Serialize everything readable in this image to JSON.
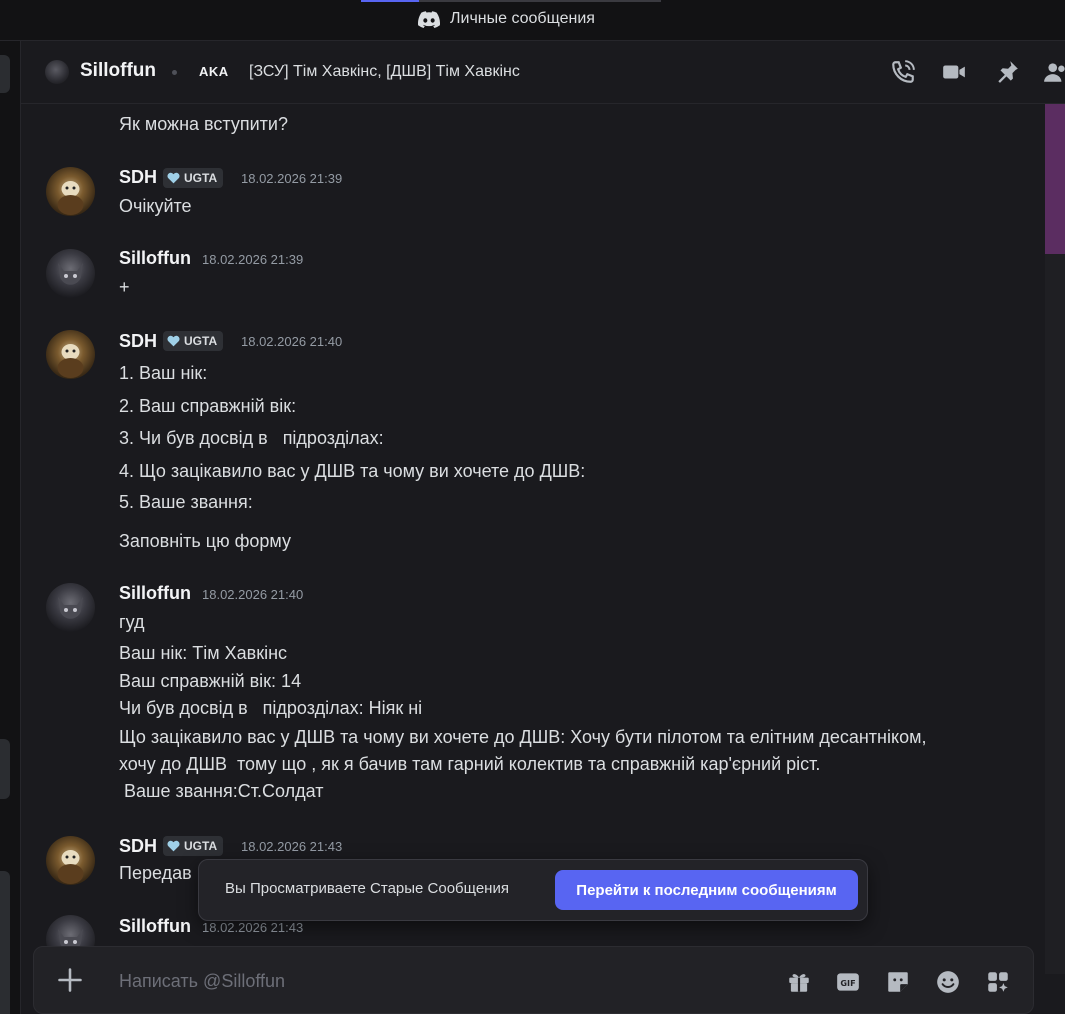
{
  "titlebar": {
    "title": "Личные сообщения"
  },
  "header": {
    "username": "Silloffun",
    "aka_label": "AKA",
    "aka_names": "[ЗСУ] Тім Хавкінс, [ДШВ] Тім Хавкінс"
  },
  "messages": {
    "top_text": "Як можна вступити?",
    "m1": {
      "author": "SDH",
      "badge": "UGTA",
      "time": "18.02.2026 21:39",
      "text": "Очікуйте"
    },
    "m2": {
      "author": "Silloffun",
      "time": "18.02.2026 21:39",
      "text": "+"
    },
    "m3": {
      "author": "SDH",
      "badge": "UGTA",
      "time": "18.02.2026 21:40",
      "lines": [
        "1. Ваш нік:",
        "2. Ваш справжній вік:",
        "3. Чи був досвід в   підрозділах:",
        "4. Що зацікавило вас у ДШВ та чому ви хочете до ДШВ:",
        "5. Ваше звання:",
        "Заповніть цю форму"
      ]
    },
    "m4": {
      "author": "Silloffun",
      "time": "18.02.2026 21:40",
      "lines": [
        "гуд",
        "Ваш нік: Тім Хавкінс",
        "Ваш справжній вік: 14",
        "Чи був досвід в   підрозділах: Ніяк ні",
        "Що зацікавило вас у ДШВ та чому ви хочете до ДШВ: Хочу бути пілотом та елітним десантніком,",
        "хочу до ДШВ  тому що , як я бачив там гарний колектив та справжній кар'єрний ріст.",
        " Ваше звання:Ст.Солдат"
      ]
    },
    "m5": {
      "author": "SDH",
      "badge": "UGTA",
      "time": "18.02.2026 21:43",
      "text": "Передав"
    },
    "m6": {
      "author": "Silloffun",
      "time": "18.02.2026 21:43"
    }
  },
  "toast": {
    "text": "Вы Просматриваете Старые Сообщения",
    "button": "Перейти к последним сообщениям"
  },
  "composer": {
    "placeholder": "Написать @Silloffun"
  },
  "colors": {
    "accent": "#5865f2",
    "background": "#1a1a1e"
  },
  "icons": [
    "discord-icon",
    "voice-call-icon",
    "video-call-icon",
    "pin-icon",
    "add-friends-icon",
    "plus-icon",
    "gift-icon",
    "gif-icon",
    "sticker-icon",
    "emoji-icon",
    "apps-icon",
    "heart-icon"
  ]
}
